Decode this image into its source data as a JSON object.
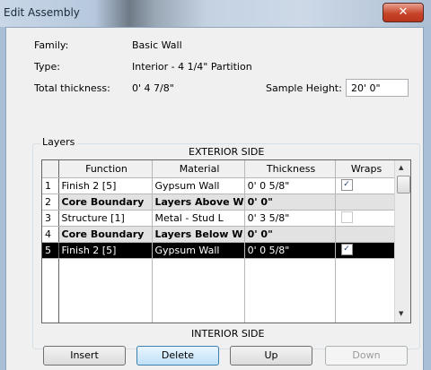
{
  "window": {
    "title": "Edit Assembly",
    "close_glyph": "✕"
  },
  "info": {
    "family_label": "Family:",
    "family_value": "Basic Wall",
    "type_label": "Type:",
    "type_value": "Interior - 4 1/4\" Partition",
    "thickness_label": "Total thickness:",
    "thickness_value": "0'  4 7/8\"",
    "sample_height_label": "Sample Height:",
    "sample_height_value": "20'  0\""
  },
  "layers": {
    "group_label": "Layers",
    "exterior_label": "EXTERIOR SIDE",
    "interior_label": "INTERIOR SIDE",
    "columns": [
      "Function",
      "Material",
      "Thickness",
      "Wraps"
    ],
    "rows": [
      {
        "num": "1",
        "function": "Finish 2 [5]",
        "material": "Gypsum Wall",
        "thickness": "0'  0 5/8\"",
        "wraps": true
      },
      {
        "num": "2",
        "function": "Core Boundary",
        "material": "Layers Above W",
        "thickness": "0'  0\"",
        "wraps": null
      },
      {
        "num": "3",
        "function": "Structure [1]",
        "material": "Metal - Stud L",
        "thickness": "0'  3 5/8\"",
        "wraps": false
      },
      {
        "num": "4",
        "function": "Core Boundary",
        "material": "Layers Below W",
        "thickness": "0'  0\"",
        "wraps": null
      },
      {
        "num": "5",
        "function": "Finish 2 [5]",
        "material": "Gypsum Wall",
        "thickness": "0'  0 5/8\"",
        "wraps": true
      }
    ],
    "selected_row": "5"
  },
  "buttons": {
    "insert": "Insert",
    "delete": "Delete",
    "up": "Up",
    "down": "Down"
  },
  "icons": {
    "scroll_up": "▲",
    "scroll_down": "▼",
    "check": "✓"
  }
}
